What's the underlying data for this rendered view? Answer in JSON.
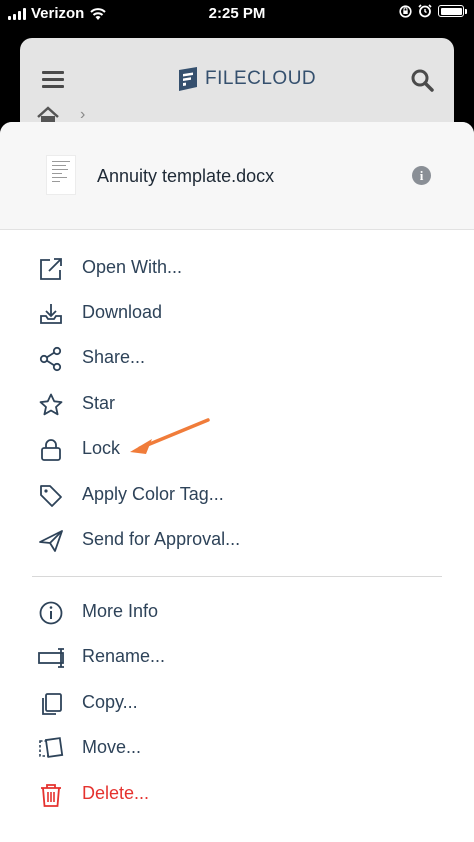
{
  "status_bar": {
    "carrier": "Verizon",
    "time": "2:25 PM"
  },
  "app_header": {
    "logo_text": "FILECLOUD"
  },
  "file": {
    "name": "Annuity template.docx",
    "info_glyph": "i"
  },
  "menu": {
    "group1": [
      {
        "label": "Open With...",
        "icon": "open-external-icon"
      },
      {
        "label": "Download",
        "icon": "download-icon"
      },
      {
        "label": "Share...",
        "icon": "share-icon"
      },
      {
        "label": "Star",
        "icon": "star-icon"
      },
      {
        "label": "Lock",
        "icon": "lock-icon"
      },
      {
        "label": "Apply Color Tag...",
        "icon": "tag-icon"
      },
      {
        "label": "Send for Approval...",
        "icon": "send-icon"
      }
    ],
    "group2": [
      {
        "label": "More Info",
        "icon": "info-icon"
      },
      {
        "label": "Rename...",
        "icon": "rename-icon"
      },
      {
        "label": "Copy...",
        "icon": "copy-icon"
      },
      {
        "label": "Move...",
        "icon": "move-icon"
      },
      {
        "label": "Delete...",
        "icon": "trash-icon"
      }
    ]
  },
  "colors": {
    "menu_text": "#2e4359",
    "danger": "#e5322e",
    "annotation_arrow": "#f07c3a",
    "brand": "#35506e"
  }
}
